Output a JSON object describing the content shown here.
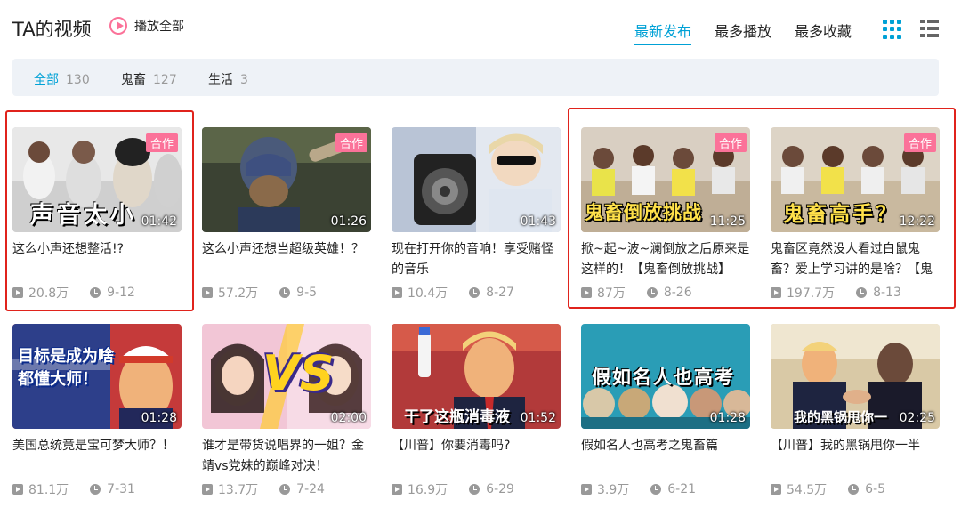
{
  "header": {
    "title": "TA的视频",
    "play_all": "播放全部",
    "sort_tabs": [
      "最新发布",
      "最多播放",
      "最多收藏"
    ],
    "active_sort": "最新发布",
    "view_icons": [
      "grid-view-icon",
      "list-view-icon"
    ],
    "accent_color": "#00a1d6"
  },
  "filter": {
    "items": [
      {
        "label": "全部",
        "count": "130"
      },
      {
        "label": "鬼畜",
        "count": "127"
      },
      {
        "label": "生活",
        "count": "3"
      }
    ]
  },
  "badge_color": "#fb7299",
  "videos": [
    {
      "title": "这么小声还想整活!?",
      "duration": "01:42",
      "views": "20.8万",
      "date": "9-12",
      "badge": "合作",
      "caption": "声音太小"
    },
    {
      "title": "这么小声还想当超级英雄！？",
      "duration": "01:26",
      "views": "57.2万",
      "date": "9-5",
      "badge": "合作",
      "caption": ""
    },
    {
      "title": "现在打开你的音响！享受赌怪的音乐",
      "duration": "01:43",
      "views": "10.4万",
      "date": "8-27",
      "badge": "",
      "caption": ""
    },
    {
      "title": "掀~起~波~澜倒放之后原来是这样的！【鬼畜倒放挑战】",
      "duration": "11:25",
      "views": "87万",
      "date": "8-26",
      "badge": "合作",
      "caption": "鬼畜倒放挑战"
    },
    {
      "title": "鬼畜区竟然没人看过白鼠鬼畜？爱上学习讲的是啥？【鬼",
      "duration": "12:22",
      "views": "197.7万",
      "date": "8-13",
      "badge": "合作",
      "caption": "鬼畜高手？"
    },
    {
      "title": "美国总统竟是宝可梦大师？！",
      "duration": "01:28",
      "views": "81.1万",
      "date": "7-31",
      "badge": "",
      "caption": "目标是成为啥都懂大师！"
    },
    {
      "title": "谁才是带货说唱界的一姐？金靖vs党妹的巅峰对决！",
      "duration": "02:00",
      "views": "13.7万",
      "date": "7-24",
      "badge": "",
      "caption": "VS"
    },
    {
      "title": "【川普】你要消毒吗?",
      "duration": "01:52",
      "views": "16.9万",
      "date": "6-29",
      "badge": "",
      "caption": "干了这瓶消毒液"
    },
    {
      "title": "假如名人也高考之鬼畜篇",
      "duration": "01:28",
      "views": "3.9万",
      "date": "6-21",
      "badge": "",
      "caption": "假如名人也高考"
    },
    {
      "title": "【川普】我的黑锅甩你一半",
      "duration": "02:25",
      "views": "54.5万",
      "date": "6-5",
      "badge": "",
      "caption": "我的黑锅甩你一"
    }
  ]
}
